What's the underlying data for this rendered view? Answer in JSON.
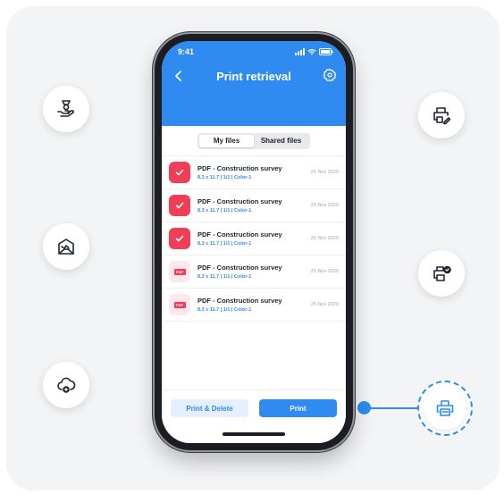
{
  "colors": {
    "accent": "#2f8bef",
    "danger": "#ef3e56",
    "card_bg": "#f3f4f6"
  },
  "side_buttons": [
    {
      "icon": "hand-money-icon"
    },
    {
      "icon": "mail-image-icon"
    },
    {
      "icon": "cloud-upload-icon"
    },
    {
      "icon": "printer-edit-icon"
    },
    {
      "icon": "printer-check-icon"
    },
    {
      "icon": "printer-icon"
    }
  ],
  "phone": {
    "status": {
      "time": "9:41"
    },
    "header": {
      "title": "Print retrieval",
      "back_icon": "chevron-left-icon",
      "settings_icon": "gear-icon"
    },
    "tabs": [
      {
        "label": "My files",
        "active": true
      },
      {
        "label": "Shared files",
        "active": false
      }
    ],
    "files": [
      {
        "title": "PDF - Construction survey",
        "meta": "8.3 x 11.7 | 1/1 | Color-1",
        "date": "25 Nov 2020",
        "state": "checked"
      },
      {
        "title": "PDF - Construction survey",
        "meta": "8.3 x 11.7 | 1/1 | Color-1",
        "date": "25 Nov 2020",
        "state": "checked"
      },
      {
        "title": "PDF - Construction survey",
        "meta": "8.3 x 11.7 | 1/1 | Color-1",
        "date": "25 Nov 2020",
        "state": "checked"
      },
      {
        "title": "PDF - Construction survey",
        "meta": "8.3 x 11.7 | 1/1 | Color-1",
        "date": "25 Nov 2020",
        "state": "pdf"
      },
      {
        "title": "PDF - Construction survey",
        "meta": "8.3 x 11.7 | 1/1 | Color-1",
        "date": "25 Nov 2020",
        "state": "pdf"
      }
    ],
    "pdf_tag": "PDF",
    "actions": {
      "secondary": "Print & Delete",
      "primary": "Print"
    }
  }
}
